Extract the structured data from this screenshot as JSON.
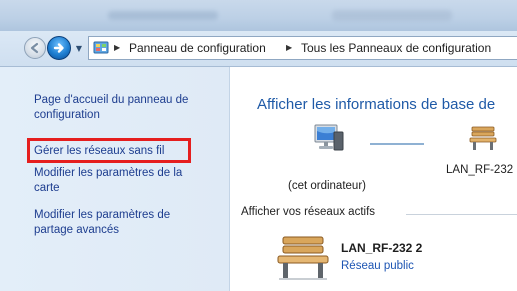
{
  "address_bar": {
    "crumbs": [
      "Panneau de configuration",
      "Tous les Panneaux de configuration"
    ]
  },
  "left_pane": {
    "links": [
      "Page d'accueil du panneau de configuration",
      "Gérer les réseaux sans fil",
      "Modifier les paramètres de la carte",
      "Modifier les paramètres de partage avancés"
    ]
  },
  "main": {
    "heading": "Afficher les informations de base de",
    "computer_label": "(cet ordinateur)",
    "network_map_label": "LAN_RF-232",
    "active_networks_label": "Afficher vos réseaux actifs",
    "active_network": {
      "name": "LAN_RF-232  2",
      "type": "Réseau public"
    }
  },
  "colors": {
    "link": "#1d3d8f",
    "heading": "#1f5aa7",
    "highlight": "#e51e1e",
    "left_pane_bg": "#e3eef9"
  }
}
